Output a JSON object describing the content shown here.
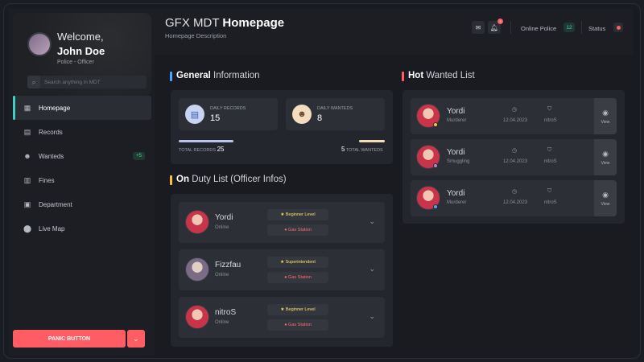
{
  "sidebar": {
    "welcome": "Welcome,",
    "user_name": "John Doe",
    "user_role": "Police - Officer",
    "search_placeholder": "Search anything in MDT",
    "items": [
      {
        "label": "Homepage",
        "icon": "grid-icon",
        "active": true
      },
      {
        "label": "Records",
        "icon": "document-icon"
      },
      {
        "label": "Wanteds",
        "icon": "wanted-icon",
        "badge": "+5"
      },
      {
        "label": "Fines",
        "icon": "receipt-icon"
      },
      {
        "label": "Department",
        "icon": "building-icon"
      },
      {
        "label": "Live Map",
        "icon": "map-pin-icon"
      }
    ],
    "panic_label": "PANIC BUTTON"
  },
  "header": {
    "title_prefix": "GFX MDT",
    "title_bold": "Homepage",
    "subtitle": "Homepage Description",
    "notification_count": "3",
    "online_label": "Online Police",
    "online_count": "12",
    "status_label": "Status"
  },
  "general": {
    "title_bold": "General",
    "title_rest": "Information",
    "daily_records_label": "DAILY RECORDS",
    "daily_records_value": "15",
    "daily_wanteds_label": "DAILY WANTEDS",
    "daily_wanteds_value": "8",
    "total_records_label": "TOTAL RECORDS",
    "total_records_value": "25",
    "total_wanteds_label": "TOTAL WANTEDS",
    "total_wanteds_value": "5"
  },
  "duty": {
    "title_bold": "On",
    "title_rest": "Duty List (Officer Infos)",
    "officers": [
      {
        "name": "Yordi",
        "status": "Online",
        "level": "Beginner Level",
        "location": "Gas Station"
      },
      {
        "name": "Fizzfau",
        "status": "Online",
        "level": "Superintendent",
        "location": "Gas Station"
      },
      {
        "name": "nitroS",
        "status": "Online",
        "level": "Beginner Level",
        "location": "Gas Station"
      }
    ]
  },
  "wanted": {
    "title_bold": "Hot",
    "title_rest": "Wanted List",
    "view_label": "View",
    "items": [
      {
        "name": "Yordi",
        "crime": "Murderer",
        "date": "12.04.2023",
        "by": "nitroS",
        "dot_color": "#f4c04a"
      },
      {
        "name": "Yordi",
        "crime": "Smuggling",
        "date": "12.04.2023",
        "by": "nitroS",
        "dot_color": "#c07bd6"
      },
      {
        "name": "Yordi",
        "crime": "Murderer",
        "date": "12.04.2023",
        "by": "nitroS",
        "dot_color": "#4ea2ff"
      }
    ]
  },
  "colors": {
    "accent_teal": "#3fd0c2",
    "danger": "#ff5c64",
    "blue": "#4ea2ff",
    "yellow": "#f4c04a"
  }
}
